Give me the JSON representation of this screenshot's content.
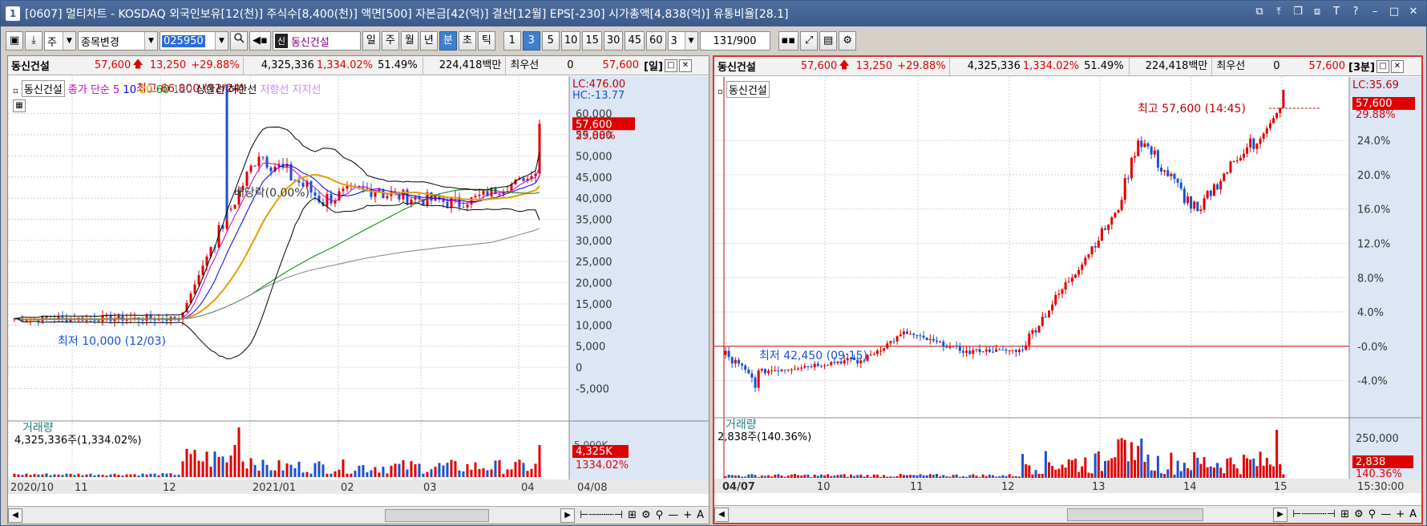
{
  "title_bar": {
    "app_number": "1",
    "text": "[0607] 멀티차트 - KOSDAQ 외국인보유[12(천)] 주식수[8,400(천)] 액면[500] 자본금[42(억)] 결산[12월] EPS[-230] 시가총액[4,838(억)] 유통비율[28.1]",
    "buttons": [
      "⧉",
      "⤒",
      "❐",
      "⧈",
      "T",
      "?",
      "–",
      "□",
      "✕"
    ]
  },
  "toolbar": {
    "icon_buttons": [
      "▣",
      "⤓"
    ],
    "market_combo": "주",
    "stock_change_combo": "종목변경",
    "code": "025950",
    "stock_tag": "신",
    "stock_name": "동신건설",
    "period_buttons": [
      "일",
      "주",
      "월",
      "년",
      "분",
      "초",
      "틱"
    ],
    "selected_period": "분",
    "minute_buttons": [
      "1",
      "3",
      "5",
      "10",
      "15",
      "30",
      "45",
      "60"
    ],
    "selected_minute": "3",
    "minute_combo": "3",
    "count": "131",
    "total": "/900"
  },
  "colors": {
    "up": "#e00000",
    "down": "#1a50d0",
    "accent": "#3f7fcf",
    "panel_border_active": "#e03030"
  },
  "left_panel": {
    "info": {
      "name": "동신건설",
      "price": "57,600",
      "arrow": "🡅",
      "change": "13,250",
      "rate": "+29.88%",
      "volume": "4,325,336",
      "vol_rate": "1,334.02%",
      "ratio": "51.49%",
      "amount": "224,418백만",
      "best_label": "최우선",
      "best_val": "0",
      "best_price": "57,600",
      "period": "[일]"
    },
    "legend": {
      "name": "동신건설",
      "items": [
        {
          "text": "종가 단순 5",
          "color": "#cc00cc"
        },
        {
          "text": "10",
          "color": "#0000ff"
        },
        {
          "text": "20",
          "color": "#e0a000"
        },
        {
          "text": "60",
          "color": "#008000"
        },
        {
          "text": "120",
          "color": "#808080"
        },
        {
          "text": "상한선",
          "color": "#000000"
        },
        {
          "text": "하한선",
          "color": "#000000"
        },
        {
          "text": "저항선",
          "color": "#cc88ff"
        },
        {
          "text": "지지선",
          "color": "#cc88ff"
        }
      ]
    },
    "annotations": {
      "high": "최고 66,800 (12/24)",
      "low": "최저 10,000 (12/03)",
      "dividend": "배당락(0.00%)",
      "lc": "LC:476.00",
      "hc": "HC:-13.77",
      "price_tag": "57,600",
      "rate_tag": "29.88%"
    },
    "y_ticks": [
      "60,000",
      "55,000",
      "50,000",
      "45,000",
      "40,000",
      "35,000",
      "30,000",
      "25,000",
      "20,000",
      "15,000",
      "10,000",
      "5,000",
      "0",
      "-5,000"
    ],
    "volume": {
      "label": "거래량",
      "value": "4,325,336주(1,334.02%)",
      "tag1": "4,325K",
      "tag2": "1334.02%",
      "tick_top": "5,000K"
    },
    "x_ticks": [
      "2020/10",
      "11",
      "12",
      "2021/01",
      "02",
      "03",
      "04"
    ],
    "x_right": "04/08"
  },
  "right_panel": {
    "info": {
      "name": "동신건설",
      "price": "57,600",
      "arrow": "🡅",
      "change": "13,250",
      "rate": "+29.88%",
      "volume": "4,325,336",
      "vol_rate": "1,334.02%",
      "ratio": "51.49%",
      "amount": "224,418백만",
      "best_label": "최우선",
      "best_val": "0",
      "best_price": "57,600",
      "period": "[3분]"
    },
    "legend": {
      "name": "동신건설"
    },
    "annotations": {
      "high": "최고 57,600 (14:45)",
      "low": "최저 42,450 (09:15)",
      "lc": "LC:35.69",
      "price_tag": "57,600",
      "rate_tag": "29.88%"
    },
    "y_ticks": [
      "24.0%",
      "20.0%",
      "16.0%",
      "12.0%",
      "8.0%",
      "4.0%",
      "-0.0%",
      "-4.0%"
    ],
    "volume": {
      "label": "거래량",
      "value": "2,838주(140.36%)",
      "tick_top": "250,000",
      "tag1": "2,838",
      "tag2": "140.36%"
    },
    "x_ticks": [
      "04/07",
      "10",
      "11",
      "12",
      "13",
      "14",
      "15"
    ],
    "x_right": "15:30:00"
  }
}
